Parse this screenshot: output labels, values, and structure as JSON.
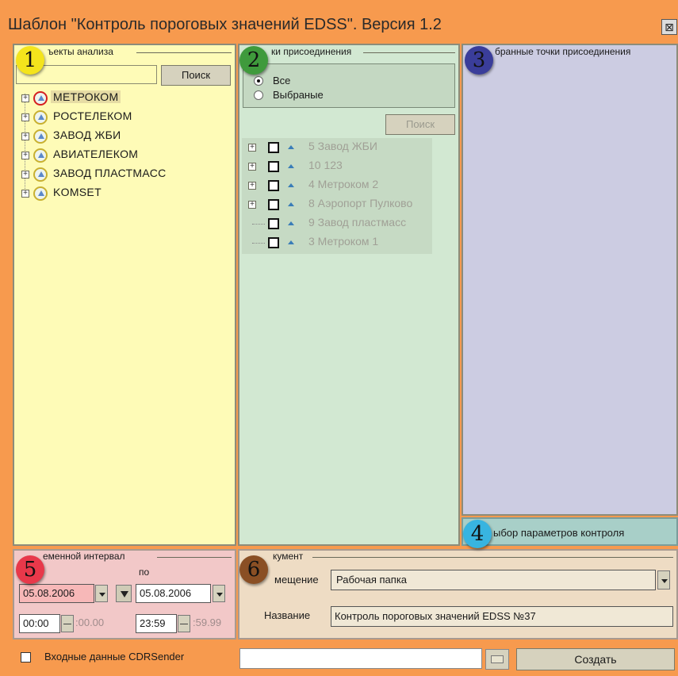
{
  "window": {
    "title": "Шаблон \"Контроль пороговых значений EDSS\". Версия 1.2"
  },
  "badges": [
    "1",
    "2",
    "3",
    "4",
    "5",
    "6"
  ],
  "panel1": {
    "label": "ъекты анализа",
    "search_button": "Поиск",
    "items": [
      {
        "label": "МЕТРОКОМ",
        "selected": true
      },
      {
        "label": "РОСТЕЛЕКОМ"
      },
      {
        "label": "ЗАВОД ЖБИ"
      },
      {
        "label": "АВИАТЕЛЕКОМ"
      },
      {
        "label": "ЗАВОД ПЛАСТМАСС"
      },
      {
        "label": "KOMSET"
      }
    ]
  },
  "panel2": {
    "label": "ки присоединения",
    "radio_all": "Все",
    "radio_selected": "Выбраные",
    "search_button": "Поиск",
    "items": [
      {
        "label": "5 Завод ЖБИ"
      },
      {
        "label": "10 123"
      },
      {
        "label": "4 Метроком 2"
      },
      {
        "label": "8 Аэропорт Пулково"
      },
      {
        "label": "9 Завод пластмасс"
      },
      {
        "label": "3 Метроком 1"
      }
    ]
  },
  "panel3": {
    "label": "бранные точки присоединения"
  },
  "panel4": {
    "label": "ыбор параметров контроля"
  },
  "panel5": {
    "label": "еменной интервал",
    "to_label": "по",
    "date_from": "05.08.2006",
    "date_to": "05.08.2006",
    "time_from": "00:00",
    "time_from_sec": ":00.00",
    "time_to": "23:59",
    "time_to_sec": ":59.99"
  },
  "panel6": {
    "label": "кумент",
    "location_label": "мещение",
    "location_value": "Рабочая папка",
    "name_label": "Название",
    "name_value": "Контроль пороговых значений EDSS №37"
  },
  "bottom": {
    "checkbox_label": "Входные данные CDRSender",
    "create_button": "Создать"
  },
  "colors": {
    "frame": "#f79a4e",
    "panel1": "#fefbb7",
    "panel2": "#d2e8d2",
    "panel3": "#cccce2",
    "panel4": "#a8cfc8",
    "panel5": "#f2c8c8",
    "panel6": "#eedcc4",
    "badge1": "#f4e41c",
    "badge2": "#3f9a3c",
    "badge3": "#3a3d9a",
    "badge4": "#38b4e0",
    "badge5": "#e8384a",
    "badge6": "#8a4f24"
  }
}
